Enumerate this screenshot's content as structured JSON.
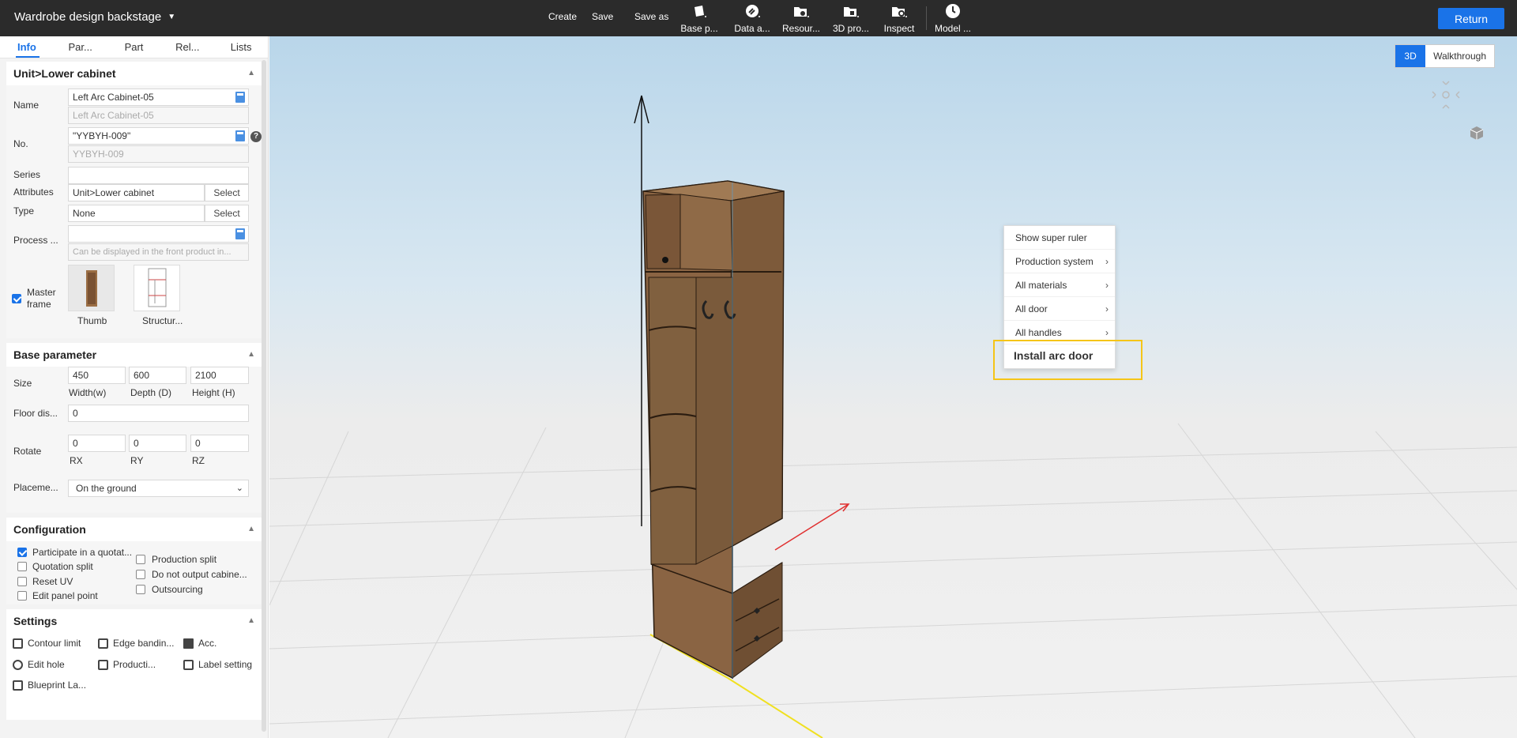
{
  "app": {
    "title": "Wardrobe design backstage",
    "return_label": "Return"
  },
  "toolbar": {
    "create": "Create",
    "save": "Save",
    "save_as": "Save as",
    "icons": [
      {
        "label": "Base p...",
        "icon": "box-icon"
      },
      {
        "label": "Data a...",
        "icon": "link-icon"
      },
      {
        "label": "Resour...",
        "icon": "folder-gear-icon"
      },
      {
        "label": "3D pro...",
        "icon": "folder-3d-icon"
      },
      {
        "label": "Inspect",
        "icon": "inspect-icon"
      },
      {
        "label": "Model ...",
        "icon": "clock-icon"
      }
    ]
  },
  "tabs": [
    "Info",
    "Par...",
    "Part",
    "Rel...",
    "Lists"
  ],
  "info": {
    "header": "Unit>Lower cabinet",
    "name_label": "Name",
    "name_value": "Left Arc Cabinet-05",
    "name_ghost": "Left Arc Cabinet-05",
    "no_label": "No.",
    "no_value": "\"YYBYH-009\"",
    "no_ghost": "YYBYH-009",
    "series_label": "Series",
    "series_value": "",
    "attributes_label": "Attributes",
    "attributes_value": "Unit>Lower cabinet",
    "select_label": "Select",
    "type_label": "Type",
    "type_value": "None",
    "process_label": "Process ...",
    "process_placeholder": "Can be displayed in the front product in...",
    "master_frame_label": "Master frame",
    "thumb_label": "Thumb",
    "structure_label": "Structur..."
  },
  "base": {
    "header": "Base parameter",
    "size_label": "Size",
    "width": "450",
    "width_label": "Width(w)",
    "depth": "600",
    "depth_label": "Depth (D)",
    "height": "2100",
    "height_label": "Height (H)",
    "floor_label": "Floor dis...",
    "floor_value": "0",
    "rotate_label": "Rotate",
    "rx": "0",
    "rx_label": "RX",
    "ry": "0",
    "ry_label": "RY",
    "rz": "0",
    "rz_label": "RZ",
    "placement_label": "Placeme...",
    "placement_value": "On the ground"
  },
  "config": {
    "header": "Configuration",
    "items": [
      {
        "label": "Participate in a quotat...",
        "checked": true
      },
      {
        "label": "Quotation split",
        "checked": false
      },
      {
        "label": "Reset UV",
        "checked": false
      },
      {
        "label": "Edit panel point",
        "checked": false
      },
      {
        "label": "Production split",
        "checked": false
      },
      {
        "label": "Do not output cabine...",
        "checked": false
      },
      {
        "label": "Outsourcing",
        "checked": false
      }
    ]
  },
  "settings": {
    "header": "Settings",
    "items": [
      "Contour limit",
      "Edge bandin...",
      "Acc.",
      "Edit hole",
      "Producti...",
      "Label setting",
      "Blueprint La..."
    ]
  },
  "viewport": {
    "mode_3d": "3D",
    "mode_walk": "Walkthrough"
  },
  "context_menu": {
    "items": [
      "Show super ruler",
      "Production system",
      "All materials",
      "All door",
      "All handles"
    ],
    "highlighted": "Install arc door"
  },
  "colors": {
    "accent": "#1a73e8",
    "topbar": "#2b2b2b",
    "highlight": "#f5c518",
    "wood": "#8a6443"
  }
}
